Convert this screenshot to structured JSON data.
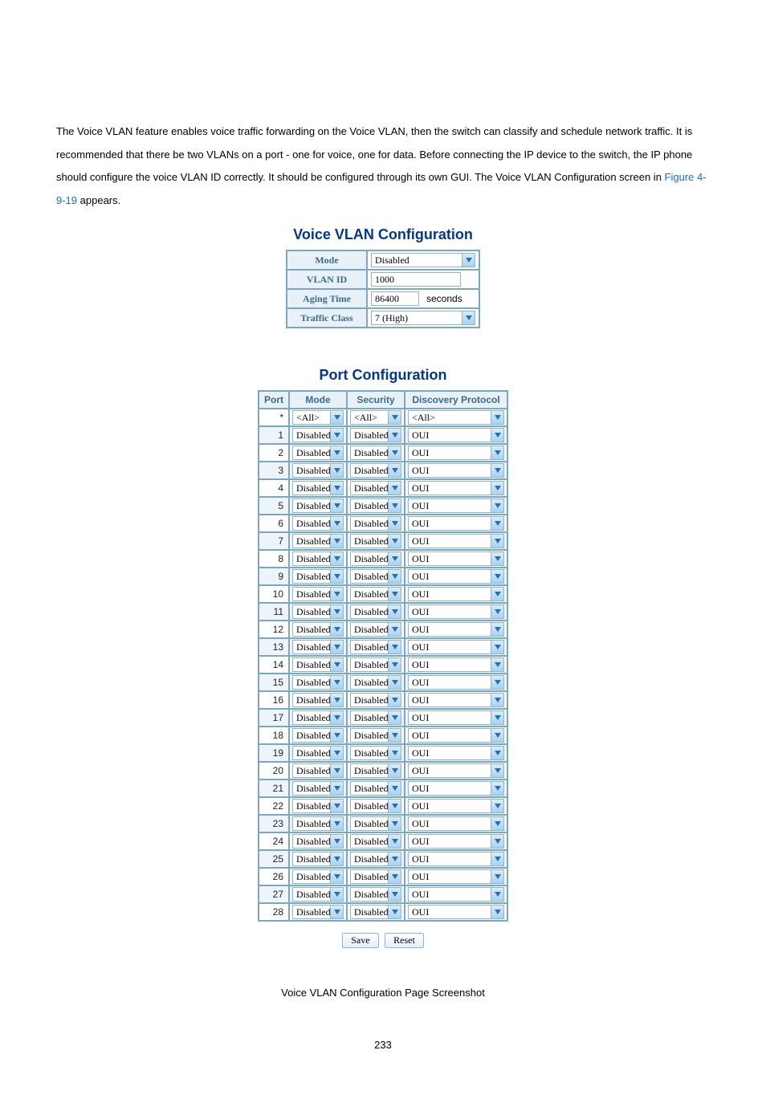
{
  "intro": {
    "text_pre": "The Voice VLAN feature enables voice traffic forwarding on the Voice VLAN, then the switch can classify and schedule network traffic. It is recommended that there be two VLANs on a port - one for voice, one for data. Before connecting the IP device to the switch, the IP phone should configure the voice VLAN ID correctly. It should be configured through its own GUI. The Voice VLAN Configuration screen in ",
    "figref": "Figure 4-9-19",
    "text_post": " appears."
  },
  "sections": {
    "config_title": "Voice VLAN Configuration",
    "port_title": "Port Configuration"
  },
  "config": {
    "rows": {
      "mode": {
        "label": "Mode",
        "value": "Disabled",
        "type": "select"
      },
      "vlan_id": {
        "label": "VLAN ID",
        "value": "1000",
        "type": "text"
      },
      "aging_time": {
        "label": "Aging Time",
        "value": "86400",
        "type": "text",
        "unit": "seconds"
      },
      "traffic_cls": {
        "label": "Traffic Class",
        "value": "7 (High)",
        "type": "select"
      }
    }
  },
  "port_table": {
    "headers": {
      "port": "Port",
      "mode": "Mode",
      "security": "Security",
      "discovery": "Discovery Protocol"
    },
    "first_row": {
      "port": "*",
      "mode": "<All>",
      "security": "<All>",
      "discovery": "<All>"
    },
    "rows": [
      {
        "port": "1",
        "mode": "Disabled",
        "security": "Disabled",
        "discovery": "OUI"
      },
      {
        "port": "2",
        "mode": "Disabled",
        "security": "Disabled",
        "discovery": "OUI"
      },
      {
        "port": "3",
        "mode": "Disabled",
        "security": "Disabled",
        "discovery": "OUI"
      },
      {
        "port": "4",
        "mode": "Disabled",
        "security": "Disabled",
        "discovery": "OUI"
      },
      {
        "port": "5",
        "mode": "Disabled",
        "security": "Disabled",
        "discovery": "OUI"
      },
      {
        "port": "6",
        "mode": "Disabled",
        "security": "Disabled",
        "discovery": "OUI"
      },
      {
        "port": "7",
        "mode": "Disabled",
        "security": "Disabled",
        "discovery": "OUI"
      },
      {
        "port": "8",
        "mode": "Disabled",
        "security": "Disabled",
        "discovery": "OUI"
      },
      {
        "port": "9",
        "mode": "Disabled",
        "security": "Disabled",
        "discovery": "OUI"
      },
      {
        "port": "10",
        "mode": "Disabled",
        "security": "Disabled",
        "discovery": "OUI"
      },
      {
        "port": "11",
        "mode": "Disabled",
        "security": "Disabled",
        "discovery": "OUI"
      },
      {
        "port": "12",
        "mode": "Disabled",
        "security": "Disabled",
        "discovery": "OUI"
      },
      {
        "port": "13",
        "mode": "Disabled",
        "security": "Disabled",
        "discovery": "OUI"
      },
      {
        "port": "14",
        "mode": "Disabled",
        "security": "Disabled",
        "discovery": "OUI"
      },
      {
        "port": "15",
        "mode": "Disabled",
        "security": "Disabled",
        "discovery": "OUI"
      },
      {
        "port": "16",
        "mode": "Disabled",
        "security": "Disabled",
        "discovery": "OUI"
      },
      {
        "port": "17",
        "mode": "Disabled",
        "security": "Disabled",
        "discovery": "OUI"
      },
      {
        "port": "18",
        "mode": "Disabled",
        "security": "Disabled",
        "discovery": "OUI"
      },
      {
        "port": "19",
        "mode": "Disabled",
        "security": "Disabled",
        "discovery": "OUI"
      },
      {
        "port": "20",
        "mode": "Disabled",
        "security": "Disabled",
        "discovery": "OUI"
      },
      {
        "port": "21",
        "mode": "Disabled",
        "security": "Disabled",
        "discovery": "OUI"
      },
      {
        "port": "22",
        "mode": "Disabled",
        "security": "Disabled",
        "discovery": "OUI"
      },
      {
        "port": "23",
        "mode": "Disabled",
        "security": "Disabled",
        "discovery": "OUI"
      },
      {
        "port": "24",
        "mode": "Disabled",
        "security": "Disabled",
        "discovery": "OUI"
      },
      {
        "port": "25",
        "mode": "Disabled",
        "security": "Disabled",
        "discovery": "OUI"
      },
      {
        "port": "26",
        "mode": "Disabled",
        "security": "Disabled",
        "discovery": "OUI"
      },
      {
        "port": "27",
        "mode": "Disabled",
        "security": "Disabled",
        "discovery": "OUI"
      },
      {
        "port": "28",
        "mode": "Disabled",
        "security": "Disabled",
        "discovery": "OUI"
      }
    ]
  },
  "buttons": {
    "save": "Save",
    "reset": "Reset"
  },
  "caption": "Voice VLAN Configuration Page Screenshot",
  "page_number": "233"
}
